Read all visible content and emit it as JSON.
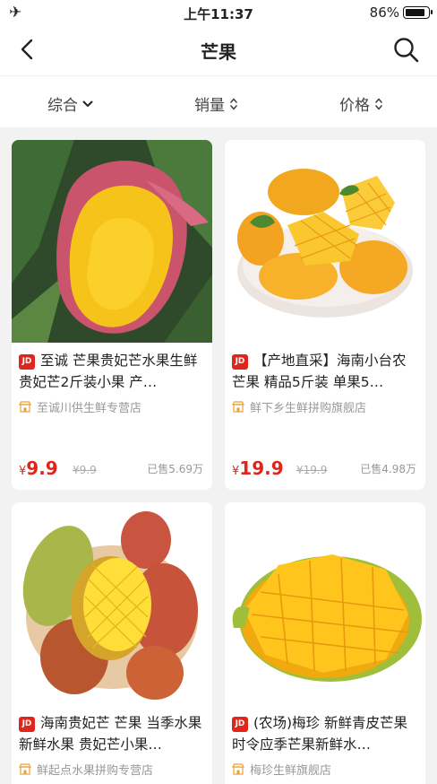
{
  "status": {
    "time": "上午11:37",
    "battery": "86%"
  },
  "nav": {
    "title": "芒果"
  },
  "sort": [
    {
      "label": "综合"
    },
    {
      "label": "销量"
    },
    {
      "label": "价格"
    }
  ],
  "badge": "JD",
  "products": [
    {
      "name": "至诚 芒果贵妃芒水果生鲜 贵妃芒2斤装小果 产…",
      "shop": "至诚川供生鲜专营店",
      "currency": "¥",
      "price": "9.9",
      "original": "¥9.9",
      "sold": "已售5.69万"
    },
    {
      "name": "【产地直采】海南小台农芒果 精品5斤装 单果5…",
      "shop": "鲜下乡生鲜拼购旗舰店",
      "currency": "¥",
      "price": "19.9",
      "original": "¥19.9",
      "sold": "已售4.98万"
    },
    {
      "name": "海南贵妃芒 芒果 当季水果 新鲜水果 贵妃芒小果…",
      "shop": "鲜起点水果拼购专营店"
    },
    {
      "name": "(农场)梅珍 新鲜青皮芒果 时令应季芒果新鲜水…",
      "shop": "梅珍生鲜旗舰店"
    }
  ]
}
